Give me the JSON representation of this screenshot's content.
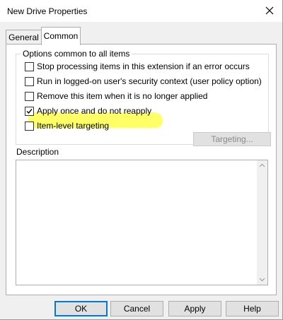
{
  "window": {
    "title": "New Drive Properties",
    "close_icon": "close-icon"
  },
  "tabs": [
    {
      "label": "General",
      "selected": false
    },
    {
      "label": "Common",
      "selected": true
    }
  ],
  "options_group": {
    "legend": "Options common to all items",
    "items": [
      {
        "label": "Stop processing items in this extension if an error occurs",
        "checked": false
      },
      {
        "label": "Run in logged-on user's security context (user policy option)",
        "checked": false
      },
      {
        "label": "Remove this item when it is no longer applied",
        "checked": false
      },
      {
        "label": "Apply once and do not reapply",
        "checked": true,
        "highlighted": true
      },
      {
        "label": "Item-level targeting",
        "checked": false
      }
    ],
    "targeting_button": "Targeting..."
  },
  "description": {
    "label": "Description",
    "value": ""
  },
  "buttons": {
    "ok": "OK",
    "cancel": "Cancel",
    "apply": "Apply",
    "help": "Help"
  },
  "colors": {
    "highlight": "#ffff33",
    "focus_border": "#0078d7"
  }
}
